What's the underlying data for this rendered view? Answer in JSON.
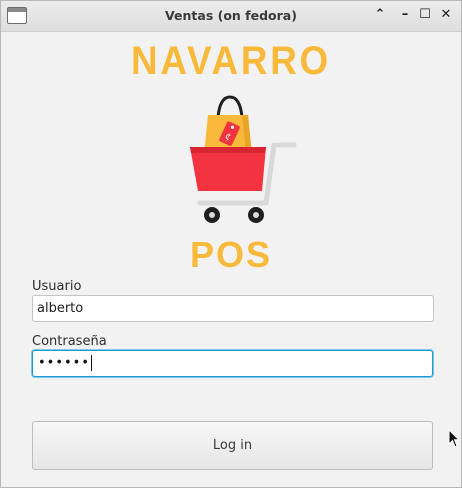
{
  "window": {
    "title": "Ventas (on fedora)",
    "controls": {
      "up": "⌃",
      "minimize": "–",
      "maximize": "☐",
      "close": "✕"
    }
  },
  "logo": {
    "brand_top": "NAVARRO",
    "brand_bottom": "POS",
    "tag_text": "¢",
    "icon": "shopping-cart-with-bag",
    "colors": {
      "brand": "#f9b93a",
      "bag": "#f9b93a",
      "cart_basket": "#f3333f",
      "wheel": "#1f1f1f",
      "frame": "#d9d9d9"
    }
  },
  "form": {
    "username_label": "Usuario",
    "username_value": "alberto",
    "password_label": "Contraseña",
    "password_value": "••••••",
    "login_label": "Log in",
    "focus_color": "#1e9bd7"
  }
}
